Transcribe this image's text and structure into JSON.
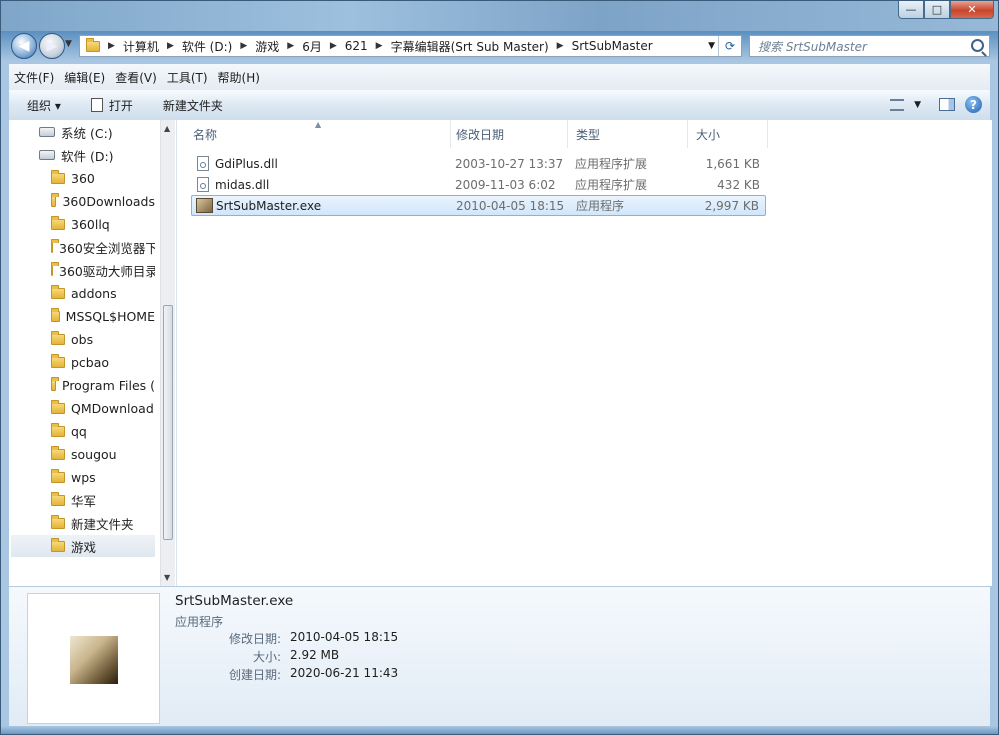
{
  "window": {
    "caption_buttons": {
      "minimize": "—",
      "maximize": "□",
      "close": "✕"
    }
  },
  "navigation": {
    "back_icon": "back-arrow-icon",
    "forward_icon": "forward-arrow-icon"
  },
  "address_bar": {
    "breadcrumbs": [
      "计算机",
      "软件 (D:)",
      "游戏",
      "6月",
      "621",
      "字幕编辑器(Srt Sub Master)",
      "SrtSubMaster"
    ]
  },
  "search": {
    "placeholder": "搜索 SrtSubMaster"
  },
  "menu": [
    "文件(F)",
    "编辑(E)",
    "查看(V)",
    "工具(T)",
    "帮助(H)"
  ],
  "toolbar": {
    "organize_label": "组织 ▾",
    "open_label": "打开",
    "new_folder_label": "新建文件夹"
  },
  "nav_tree": [
    {
      "label": "系统 (C:)",
      "kind": "drive"
    },
    {
      "label": "软件 (D:)",
      "kind": "drive"
    },
    {
      "label": "360",
      "kind": "folder"
    },
    {
      "label": "360Downloads",
      "kind": "folder"
    },
    {
      "label": "360llq",
      "kind": "folder"
    },
    {
      "label": "360安全浏览器下",
      "kind": "folder"
    },
    {
      "label": "360驱动大师目录",
      "kind": "folder"
    },
    {
      "label": "addons",
      "kind": "folder"
    },
    {
      "label": "MSSQL$HOME",
      "kind": "folder"
    },
    {
      "label": "obs",
      "kind": "folder"
    },
    {
      "label": "pcbao",
      "kind": "folder"
    },
    {
      "label": "Program Files (",
      "kind": "folder"
    },
    {
      "label": "QMDownload",
      "kind": "folder"
    },
    {
      "label": "qq",
      "kind": "folder"
    },
    {
      "label": "sougou",
      "kind": "folder"
    },
    {
      "label": "wps",
      "kind": "folder"
    },
    {
      "label": "华军",
      "kind": "folder"
    },
    {
      "label": "新建文件夹",
      "kind": "folder"
    },
    {
      "label": "游戏",
      "kind": "folder",
      "selected": true
    }
  ],
  "columns": {
    "name": "名称",
    "modified": "修改日期",
    "type": "类型",
    "size": "大小"
  },
  "files": [
    {
      "name": "GdiPlus.dll",
      "modified": "2003-10-27 13:37",
      "type": "应用程序扩展",
      "size": "1,661 KB",
      "icon": "dll-file-icon"
    },
    {
      "name": "midas.dll",
      "modified": "2009-11-03 6:02",
      "type": "应用程序扩展",
      "size": "432 KB",
      "icon": "dll-file-icon"
    },
    {
      "name": "SrtSubMaster.exe",
      "modified": "2010-04-05 18:15",
      "type": "应用程序",
      "size": "2,997 KB",
      "icon": "exe-file-icon",
      "selected": true
    }
  ],
  "details": {
    "name": "SrtSubMaster.exe",
    "type": "应用程序",
    "modified_label": "修改日期:",
    "modified": "2010-04-05 18:15",
    "size_label": "大小:",
    "size": "2.92 MB",
    "created_label": "创建日期:",
    "created": "2020-06-21 11:43"
  },
  "colors": {
    "selection": "#d1e6fb",
    "selection_border": "#7eb4ea",
    "header_text": "#4c607a"
  }
}
